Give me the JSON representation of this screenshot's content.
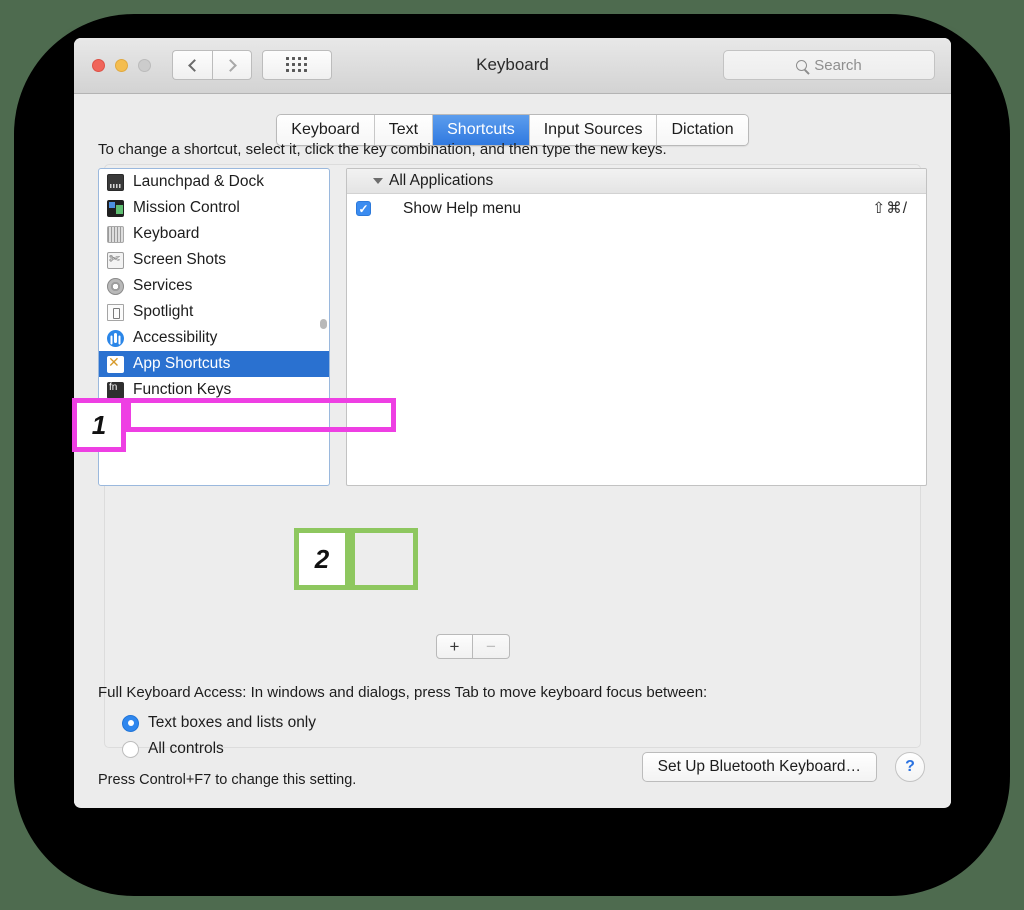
{
  "window": {
    "title": "Keyboard",
    "traffic_lights": [
      "close",
      "minimize",
      "zoom"
    ],
    "nav_back": "back-chevron",
    "nav_forward": "forward-chevron",
    "grid_button": "show-all-preferences",
    "search": {
      "placeholder": "Search",
      "value": "",
      "icon": "search-icon"
    }
  },
  "tabs": [
    {
      "label": "Keyboard",
      "active": false
    },
    {
      "label": "Text",
      "active": false
    },
    {
      "label": "Shortcuts",
      "active": true
    },
    {
      "label": "Input Sources",
      "active": false
    },
    {
      "label": "Dictation",
      "active": false
    }
  ],
  "panel": {
    "instruction": "To change a shortcut, select it, click the key combination, and then type the new keys."
  },
  "sidebar": {
    "items": [
      {
        "label": "Launchpad & Dock",
        "icon": "launchpad-dock-icon",
        "selected": false
      },
      {
        "label": "Mission Control",
        "icon": "mission-control-icon",
        "selected": false
      },
      {
        "label": "Keyboard",
        "icon": "keyboard-icon",
        "selected": false
      },
      {
        "label": "Screen Shots",
        "icon": "screen-shots-icon",
        "selected": false
      },
      {
        "label": "Services",
        "icon": "services-gear-icon",
        "selected": false
      },
      {
        "label": "Spotlight",
        "icon": "spotlight-icon",
        "selected": false
      },
      {
        "label": "Accessibility",
        "icon": "accessibility-icon",
        "selected": false
      },
      {
        "label": "App Shortcuts",
        "icon": "app-store-icon",
        "selected": true
      },
      {
        "label": "Function Keys",
        "icon": "fn-key-icon",
        "selected": false
      }
    ]
  },
  "shortcut_list": {
    "group_label": "All Applications",
    "disclosure": "disclosure-triangle-open",
    "rows": [
      {
        "checked": true,
        "name": "Show Help menu",
        "keys": "⇧⌘/"
      }
    ]
  },
  "list_buttons": {
    "add_label": "+",
    "remove_label": "−"
  },
  "full_keyboard_access": {
    "label": "Full Keyboard Access: In windows and dialogs, press Tab to move keyboard focus between:",
    "options": [
      {
        "label": "Text boxes and lists only",
        "selected": true
      },
      {
        "label": "All controls",
        "selected": false
      }
    ],
    "note": "Press Control+F7 to change this setting."
  },
  "footer": {
    "bluetooth_button": "Set Up Bluetooth Keyboard…",
    "help_button": "?"
  },
  "annotations": [
    {
      "number": "1",
      "color": "#ee3fe3",
      "target": "App Shortcuts sidebar item"
    },
    {
      "number": "2",
      "color": "#8ec75f",
      "target": "Add shortcut plus button"
    }
  ],
  "colors": {
    "accent_blue": "#2a71d0",
    "tab_active": "#3079e0",
    "annotation_magenta": "#ee3fe3",
    "annotation_green": "#8ec75f",
    "backdrop_green": "#4e6b4f"
  }
}
